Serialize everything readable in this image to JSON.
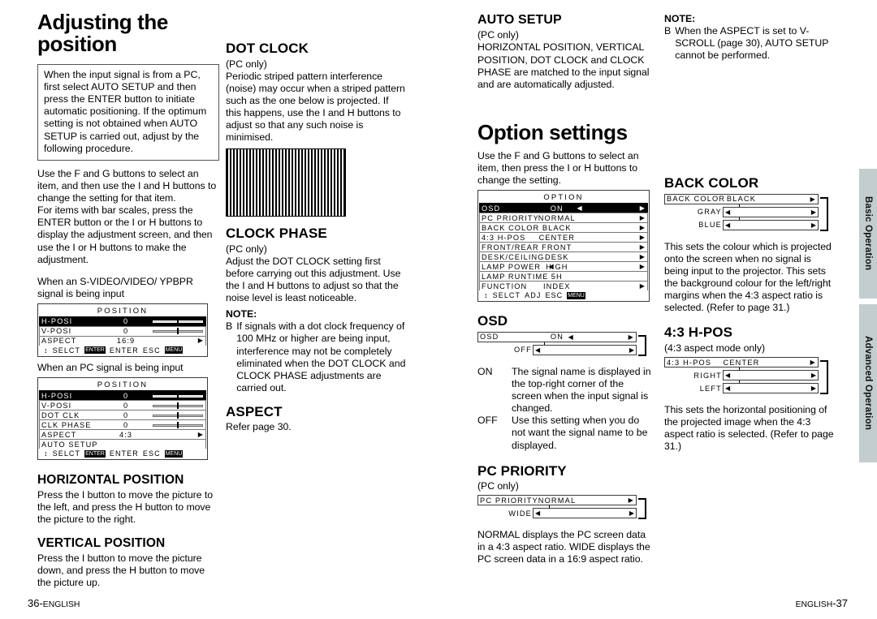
{
  "left_page": {
    "title": "Adjusting the position",
    "intro_box": "When the input signal is from a PC, first select AUTO SETUP and then press the ENTER button to initiate automatic positioning. If the optimum setting is not obtained when AUTO SETUP is carried out, adjust by the following procedure.",
    "instructions_1": "Use the F  and G  buttons to select an item, and then use the I    and H  buttons to change the setting for that item.",
    "instructions_2": "For items with bar scales, press the ENTER button or the I    or H  buttons to display the adjustment screen, and then use the I    or H  buttons to make the adjustment.",
    "caption_video": "When an S-VIDEO/VIDEO/ YPBPR signal is being input",
    "caption_pc": "When an PC signal is being input",
    "osd_video": {
      "title": "POSITION",
      "rows": [
        {
          "name": "H-POSI",
          "value": "0",
          "widget": "bar",
          "selected": true
        },
        {
          "name": "V-POSI",
          "value": "0",
          "widget": "bar",
          "selected": false
        },
        {
          "name": "ASPECT",
          "value": "16:9",
          "widget": "arrow",
          "selected": false
        }
      ],
      "footer": {
        "select": "SELCT",
        "enter": "ENTER",
        "esc": "ESC",
        "enter_chip": "ENTER",
        "esc_chip": "MENU"
      }
    },
    "osd_pc": {
      "title": "POSITION",
      "rows": [
        {
          "name": "H-POSI",
          "value": "0",
          "widget": "bar",
          "selected": true
        },
        {
          "name": "V-POSI",
          "value": "0",
          "widget": "bar",
          "selected": false
        },
        {
          "name": "DOT CLK",
          "value": "0",
          "widget": "bar",
          "selected": false
        },
        {
          "name": "CLK PHASE",
          "value": "0",
          "widget": "bar",
          "selected": false
        },
        {
          "name": "ASPECT",
          "value": "4:3",
          "widget": "arrow",
          "selected": false
        },
        {
          "name": "AUTO SETUP",
          "value": "",
          "widget": "none",
          "selected": false
        }
      ],
      "footer": {
        "select": "SELCT",
        "enter": "ENTER",
        "esc": "ESC",
        "enter_chip": "ENTER",
        "esc_chip": "MENU"
      }
    },
    "sections": {
      "dot_clock": {
        "heading": "DOT CLOCK",
        "sub": "(PC only)",
        "body": "Periodic striped pattern interference (noise) may occur when a striped pattern such as the one below is projected. If this happens, use the I    and H  buttons to adjust so that any such noise is minimised."
      },
      "clock_phase": {
        "heading": "CLOCK PHASE",
        "sub": "(PC only)",
        "body": "Adjust the DOT CLOCK setting first before carrying out this adjustment. Use the I    and H  buttons to adjust so that the noise level is least noticeable.",
        "note_label": "NOTE:",
        "note_bullet": "B",
        "note_text": "If signals with a dot clock frequency of 100 MHz or higher are being input, interference may not be completely eliminated when the DOT CLOCK and CLOCK PHASE adjustments are carried out."
      },
      "aspect": {
        "heading": "ASPECT",
        "body": "Refer page 30."
      },
      "horizontal_position": {
        "heading": "HORIZONTAL POSITION",
        "body": "Press the I    button to move the picture to the left, and press the H  button to move the picture to the right."
      },
      "vertical_position": {
        "heading": "VERTICAL POSITION",
        "body": "Press the I    button to move the picture down, and press the H  button to move the picture up."
      }
    },
    "footer": {
      "page": "36-",
      "lang": "ENGLISH"
    }
  },
  "right_page": {
    "auto_setup": {
      "heading": "AUTO SETUP",
      "sub": "(PC only)",
      "body": "HORIZONTAL POSITION, VERTICAL POSITION, DOT CLOCK and CLOCK PHASE are matched to the input signal and are automatically adjusted."
    },
    "auto_setup_note": {
      "label": "NOTE:",
      "bullet": "B",
      "text": "When the ASPECT is set to V-SCROLL (page 30), AUTO SETUP cannot be performed."
    },
    "title": "Option settings",
    "intro": "Use the F  and G  buttons to select an item, then press the I    or H  buttons to change the setting.",
    "osd_option": {
      "title": "OPTION",
      "rows": [
        {
          "name": "OSD",
          "value": "ON",
          "left_arrow": true,
          "right_arrow": true,
          "selected": true
        },
        {
          "name": "PC PRIORITY",
          "value": "NORMAL",
          "left_arrow": false,
          "right_arrow": true,
          "selected": false
        },
        {
          "name": "BACK COLOR",
          "value": "BLACK",
          "left_arrow": false,
          "right_arrow": true,
          "selected": false
        },
        {
          "name": "4:3 H-POS",
          "value": "CENTER",
          "left_arrow": false,
          "right_arrow": true,
          "selected": false
        },
        {
          "name": "FRONT/REAR",
          "value": "FRONT",
          "left_arrow": false,
          "right_arrow": true,
          "selected": false
        },
        {
          "name": "DESK/CEILING",
          "value": "DESK",
          "left_arrow": false,
          "right_arrow": true,
          "selected": false
        },
        {
          "name": "LAMP POWER",
          "value": "HIGH",
          "left_arrow": true,
          "right_arrow": true,
          "selected": false
        },
        {
          "name": "LAMP RUNTIME",
          "value": "5H",
          "left_arrow": false,
          "right_arrow": false,
          "selected": false
        },
        {
          "name": "FUNCTION",
          "value": "INDEX",
          "left_arrow": false,
          "right_arrow": true,
          "selected": false
        }
      ],
      "footer": {
        "select": "SELCT",
        "adj": "ADJ",
        "esc": "ESC",
        "esc_chip": "MENU"
      }
    },
    "osd_section": {
      "heading": "OSD",
      "strip": {
        "name": "OSD",
        "value": "ON"
      },
      "options": [
        "OFF"
      ],
      "definitions": [
        {
          "term": "ON",
          "desc": "The signal name is displayed in the top-right corner of the screen when the input signal is changed."
        },
        {
          "term": "OFF",
          "desc": "Use this setting when you do not want the signal name to be displayed."
        }
      ]
    },
    "pc_priority": {
      "heading": "PC PRIORITY",
      "sub": "(PC only)",
      "strip": {
        "name": "PC PRIORITY",
        "value": "NORMAL"
      },
      "options": [
        "WIDE"
      ],
      "body": "NORMAL displays the PC screen data in a 4:3 aspect ratio. WIDE displays the PC screen data in a 16:9 aspect ratio."
    },
    "back_color": {
      "heading": "BACK COLOR",
      "strip": {
        "name": "BACK COLOR",
        "value": "BLACK"
      },
      "options": [
        "GRAY",
        "BLUE"
      ],
      "body": "This sets the colour which is projected onto the screen when no signal is being input to the projector. This sets the background colour for the left/right margins when the 4:3 aspect ratio is selected. (Refer to page 31.)"
    },
    "h_pos_43": {
      "heading": "4:3 H-POS",
      "sub": "(4:3 aspect mode only)",
      "strip": {
        "name": "4:3 H-POS",
        "value": "CENTER"
      },
      "options": [
        "RIGHT",
        "LEFT"
      ],
      "body": "This sets the horizontal positioning of the projected image when the 4:3 aspect ratio is selected. (Refer to page 31.)"
    },
    "footer": {
      "lang": "ENGLISH",
      "page": "-37"
    }
  },
  "side_tabs": [
    {
      "label": "Basic Operation"
    },
    {
      "label": "Advanced Operation"
    }
  ],
  "glyphs": {
    "arrow_right": "▶",
    "arrow_left": "◀",
    "updown": "↕"
  }
}
